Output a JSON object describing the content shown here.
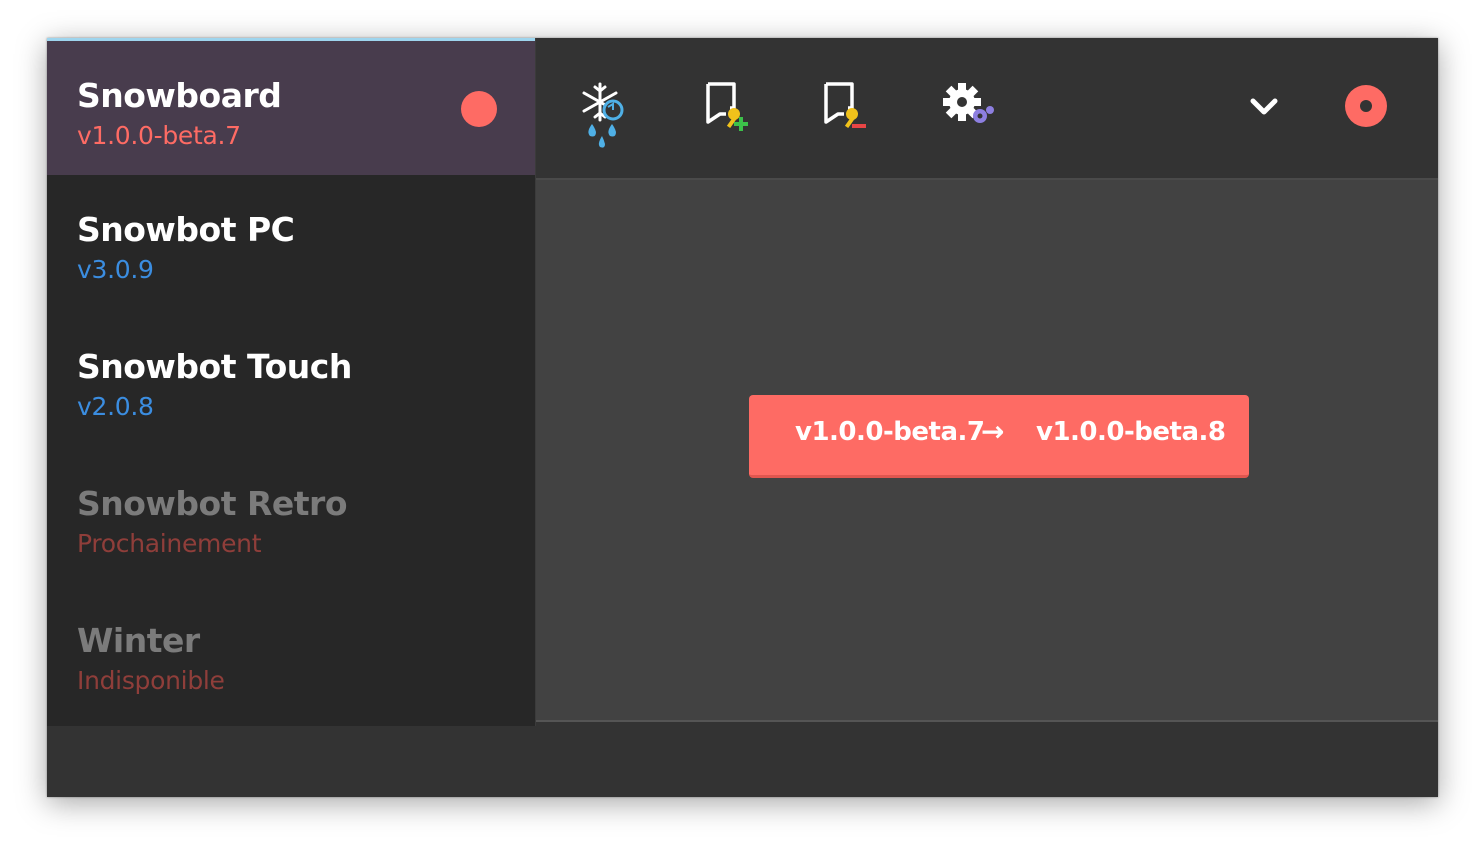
{
  "sidebar": {
    "items": [
      {
        "name": "Snowboard",
        "version": "v1.0.0-beta.7"
      },
      {
        "name": "Snowbot PC",
        "version": "v3.0.9"
      },
      {
        "name": "Snowbot Touch",
        "version": "v2.0.8"
      },
      {
        "name": "Snowbot Retro",
        "version": "Prochainement"
      },
      {
        "name": "Winter",
        "version": "Indisponible"
      }
    ]
  },
  "toolbar": {
    "icons": [
      "snowflake-sync-icon",
      "key-add-icon",
      "key-remove-icon",
      "gear-settings-icon",
      "chevron-down-icon",
      "record-icon"
    ]
  },
  "update": {
    "from": "v1.0.0-beta.7",
    "arrow": "→",
    "to": "v1.0.0-beta.8"
  },
  "colors": {
    "accent": "#fe6b64",
    "active_bg": "#483c4d",
    "link_blue": "#3b8de0",
    "muted_red": "#8f3e3a"
  }
}
